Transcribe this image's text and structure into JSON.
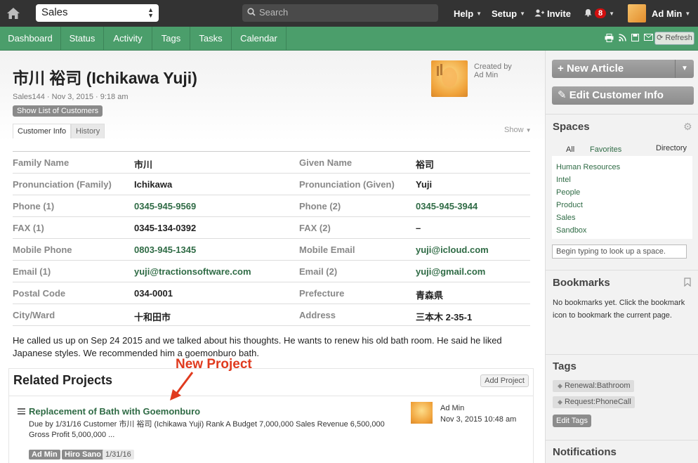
{
  "topbar": {
    "space_select": "Sales",
    "search_placeholder": "Search",
    "help": "Help",
    "setup": "Setup",
    "invite": "Invite",
    "notification_count": "8",
    "user_name": "Ad Min"
  },
  "nav": {
    "tabs": [
      "Dashboard",
      "Status",
      "Activity",
      "Tags",
      "Tasks",
      "Calendar"
    ],
    "refresh": "Refresh"
  },
  "article": {
    "title": "市川 裕司 (Ichikawa Yuji)",
    "meta": "Sales144 · Nov 3, 2015 · 9:18 am",
    "show_list_button": "Show List of Customers",
    "created_by": "Created by",
    "created_by_user": "Ad Min",
    "tabs": [
      "Customer Info",
      "History"
    ],
    "show": "Show",
    "fields": [
      {
        "l1": "Family Name",
        "v1": "市川",
        "v1_link": false,
        "l2": "Given Name",
        "v2": "裕司",
        "v2_link": false
      },
      {
        "l1": "Pronunciation (Family)",
        "v1": "Ichikawa",
        "v1_link": false,
        "l2": "Pronunciation (Given)",
        "v2": "Yuji",
        "v2_link": false
      },
      {
        "l1": "Phone (1)",
        "v1": "0345-945-9569",
        "v1_link": true,
        "l2": "Phone (2)",
        "v2": "0345-945-3944",
        "v2_link": true
      },
      {
        "l1": "FAX (1)",
        "v1": "0345-134-0392",
        "v1_link": false,
        "l2": "FAX (2)",
        "v2": "–",
        "v2_link": false
      },
      {
        "l1": "Mobile Phone",
        "v1": "0803-945-1345",
        "v1_link": true,
        "l2": "Mobile Email",
        "v2": "yuji@icloud.com",
        "v2_link": true
      },
      {
        "l1": "Email (1)",
        "v1": "yuji@tractionsoftware.com",
        "v1_link": true,
        "l2": "Email (2)",
        "v2": "yuji@gmail.com",
        "v2_link": true
      },
      {
        "l1": "Postal Code",
        "v1": "034-0001",
        "v1_link": false,
        "l2": "Prefecture",
        "v2": "青森県",
        "v2_link": false
      },
      {
        "l1": "City/Ward",
        "v1": "十和田市",
        "v1_link": false,
        "l2": "Address",
        "v2": "三本木 2-35-1",
        "v2_link": false
      }
    ],
    "description": "He called us up on Sep 24 2015 and we talked about his thoughts. He wants to renew his old bath room. He said he liked Japanese styles. We recommended him a goemonburo bath."
  },
  "related": {
    "heading": "Related Projects",
    "add_button": "Add Project",
    "annotation": "New Project",
    "project": {
      "title": "Replacement of Bath with Goemonburo",
      "description": "Due by 1/31/16 Customer 市川 裕司 (Ichikawa Yuji) Rank A Budget 7,000,000 Sales Revenue 6,500,000 Gross Profit 5,000,000 ...",
      "tags": [
        "Ad Min",
        "Hiro Sano",
        "1/31/16"
      ],
      "author": "Ad Min",
      "date": "Nov 3, 2015 10:48 am"
    }
  },
  "sidebar": {
    "new_article": "New Article",
    "edit_customer": "Edit Customer Info",
    "spaces_heading": "Spaces",
    "spaces_tabs": [
      "All",
      "Favorites",
      "Directory"
    ],
    "spaces_list": [
      "Human Resources",
      "Intel",
      "People",
      "Product",
      "Sales",
      "Sandbox"
    ],
    "space_lookup_placeholder": "Begin typing to look up a space.",
    "bookmarks_heading": "Bookmarks",
    "bookmarks_text": "No bookmarks yet. Click the bookmark icon to bookmark the current page.",
    "tags_heading": "Tags",
    "tags": [
      "Renewal:Bathroom",
      "Request:PhoneCall"
    ],
    "edit_tags": "Edit Tags",
    "notifications_heading": "Notifications"
  },
  "colors": {
    "nav_green": "#4b9e6b",
    "link_green": "#2f6b45",
    "topbar": "#333333",
    "annotation_red": "#e03a1e"
  }
}
